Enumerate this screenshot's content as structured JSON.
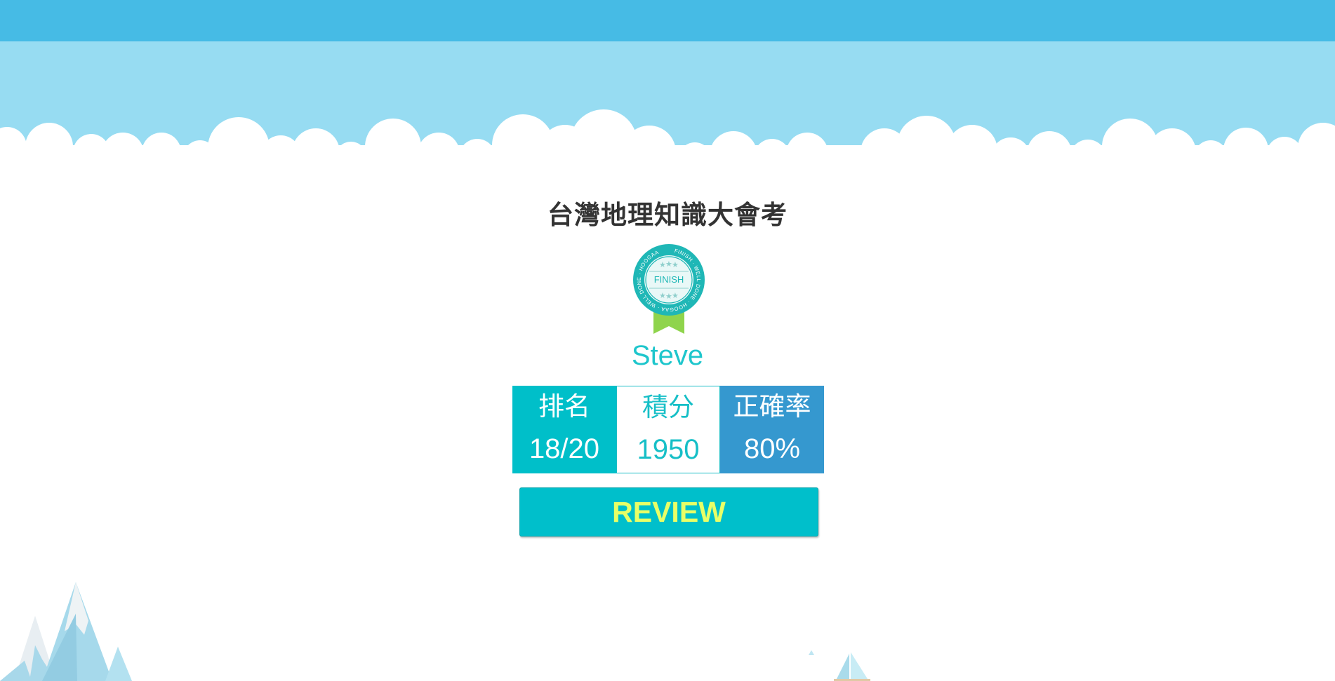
{
  "quiz": {
    "title": "台灣地理知識大會考"
  },
  "badge": {
    "center_text": "FINISH",
    "ring_text": "FINISH · WELL DONE · HOOGAA · WELL DONE · HOOGAA"
  },
  "player": {
    "name": "Steve"
  },
  "stats": [
    {
      "label": "排名",
      "value": "18/20"
    },
    {
      "label": "積分",
      "value": "1950"
    },
    {
      "label": "正確率",
      "value": "80%"
    }
  ],
  "actions": {
    "review_label": "REVIEW"
  },
  "colors": {
    "top_bar": "#46bbe5",
    "sky": "#97dcf2",
    "accent_teal": "#00bfc9",
    "accent_blue": "#3598cf",
    "review_text": "#e8ff66",
    "badge_ribbon": "#8fd44c"
  }
}
